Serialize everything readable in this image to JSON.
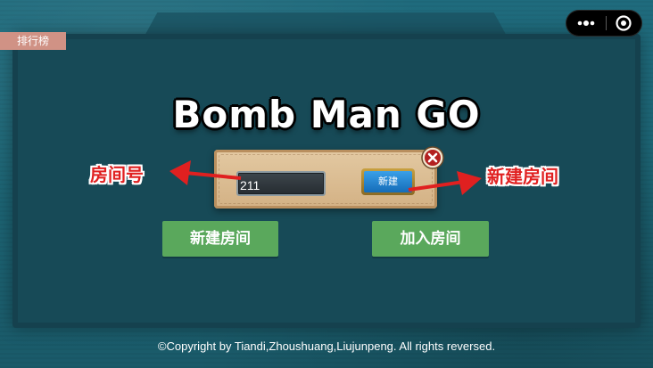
{
  "leaderboard_label": "排行榜",
  "capsule": {
    "menu_icon": "more-dots-icon",
    "close_icon": "target-circle-icon"
  },
  "title": "Bomb Man GO",
  "dialog": {
    "room_input_value": "211",
    "create_button_label": "新建",
    "close_icon": "close-x-icon"
  },
  "buttons": {
    "create_room": "新建房间",
    "join_room": "加入房间"
  },
  "annotations": {
    "room_number": "房间号",
    "new_room": "新建房间",
    "color": "#e02020"
  },
  "footer": "©Copyright  by Tiandi,Zhoushuang,Liujunpeng. All rights reversed.",
  "colors": {
    "background": "#1f6b7d",
    "green_button": "#5aa85c",
    "leaderboard_tag": "#d09285",
    "blue_button": "#1a7fd0"
  }
}
